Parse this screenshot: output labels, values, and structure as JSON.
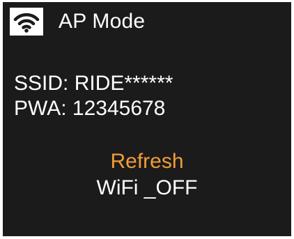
{
  "header": {
    "icon": "wifi-icon",
    "title": "AP Mode"
  },
  "info": {
    "ssid": "SSID: RIDE******",
    "pwa": "PWA: 12345678"
  },
  "menu": {
    "items": [
      {
        "label": "Refresh",
        "selected": true
      },
      {
        "label": "WiFi _OFF",
        "selected": false
      }
    ]
  },
  "colors": {
    "background": "#1b1b1b",
    "text": "#ffffff",
    "accent": "#f29c38",
    "icon_box": "#ffffff",
    "icon": "#1b1b1b"
  }
}
